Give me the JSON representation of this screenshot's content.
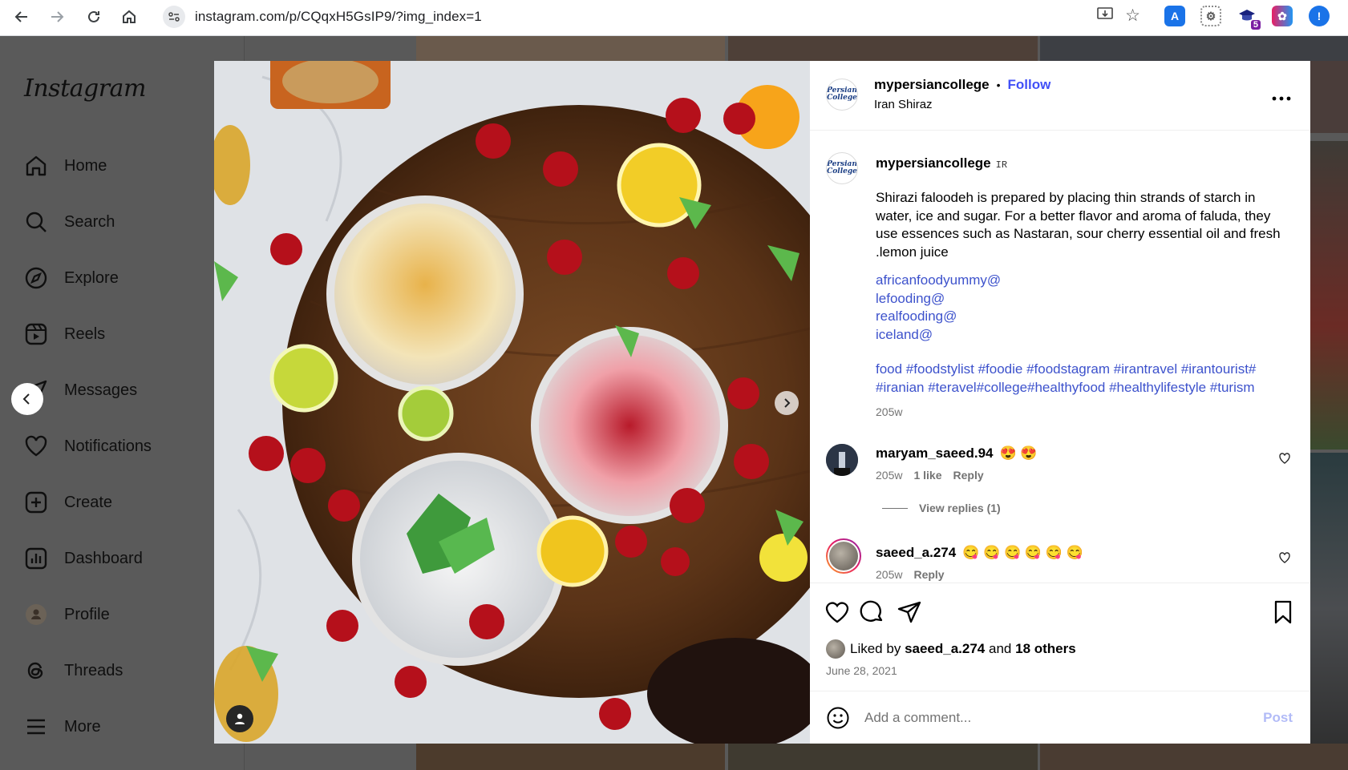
{
  "browser": {
    "url": "instagram.com/p/CQqxH5GsIP9/?img_index=1",
    "extension_badge": "5"
  },
  "sidebar": {
    "logo": "Instagram",
    "items": [
      {
        "label": "Home",
        "icon": "home-icon"
      },
      {
        "label": "Search",
        "icon": "search-icon"
      },
      {
        "label": "Explore",
        "icon": "compass-icon"
      },
      {
        "label": "Reels",
        "icon": "reels-icon"
      },
      {
        "label": "Messages",
        "icon": "messenger-icon"
      },
      {
        "label": "Notifications",
        "icon": "heart-icon"
      },
      {
        "label": "Create",
        "icon": "plus-square-icon"
      },
      {
        "label": "Dashboard",
        "icon": "dashboard-icon"
      },
      {
        "label": "Profile",
        "icon": "profile-avatar"
      },
      {
        "label": "Threads",
        "icon": "threads-icon"
      },
      {
        "label": "More",
        "icon": "menu-icon"
      }
    ]
  },
  "post": {
    "author": "mypersiancollege",
    "follow_label": "Follow",
    "separator": "•",
    "location": "Iran Shiraz",
    "avatar_text": "Persian College",
    "caption_author": "mypersiancollege",
    "caption_author_badge": "IR",
    "caption": "Shirazi faloodeh is prepared by placing thin strands of starch in water, ice and sugar. For a better flavor and aroma of faluda, they use essences such as Nastaran, sour cherry essential oil and fresh .lemon juice",
    "mentions": [
      "africanfoodyummy@",
      "lefooding@",
      "realfooding@",
      "iceland@"
    ],
    "hashtags": "food #foodstylist #foodie #foodstagram #irantravel #irantourist# #iranian #teravel#college#healthyfood #healthylifestyle #turism",
    "caption_age": "205w",
    "comments": [
      {
        "user": "maryam_saeed.94",
        "text": "😍 😍",
        "age": "205w",
        "likes": "1 like",
        "reply": "Reply",
        "view_replies": "View replies (1)"
      },
      {
        "user": "saeed_a.274",
        "text": "😋 😋 😋 😋 😋 😋",
        "age": "205w",
        "reply": "Reply"
      }
    ],
    "liked_by_prefix": "Liked by",
    "liked_by_user": "saeed_a.274",
    "liked_by_and": "and",
    "liked_by_others": "18 others",
    "date": "June 28, 2021",
    "comment_placeholder": "Add a comment...",
    "post_label": "Post"
  },
  "colors": {
    "link": "#3d52cc",
    "follow": "#4150f7",
    "post_disabled": "#b2bbf7"
  }
}
